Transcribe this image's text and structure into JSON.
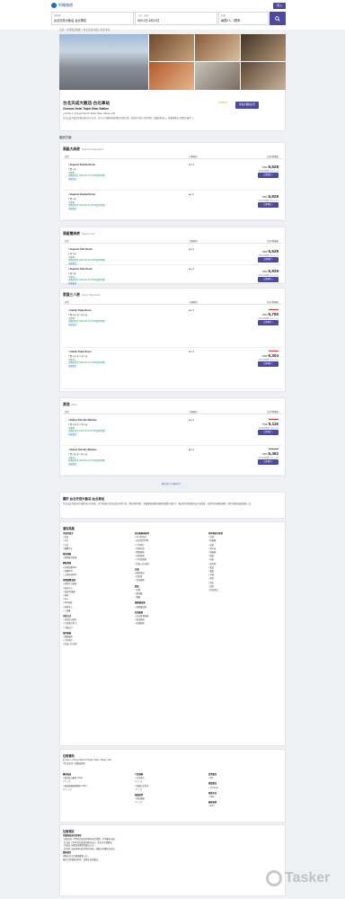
{
  "header": {
    "logo_text": "阿頓旅遊",
    "login_label": "登入",
    "search": {
      "dest_label": "目的地",
      "dest_value": "台北天成大飯店-台北車站",
      "date_label": "入住 - 退房",
      "date_value": "8月12日-8月13日",
      "guest_label": "房客",
      "guest_value": "每間2人, 1間房"
    }
  },
  "breadcrumb": "首頁 > 台灣飯店推薦 > 台北天成大飯店-台北車站",
  "hotel": {
    "name": "台北天成大飯店-台北車站",
    "name_en": "Cosmos Hotel Taipei Main Station",
    "address": "43 Sec 1, Chung Hsiao W. Road, Taipei, Taiwan, 100",
    "desc": "台北天成大飯店坐落於臺北市中正區，位於公共運輸站點與觀光商場之間，從此地可前往台北地標，周邊景點多元，距離捷運站只需數分鐘步行。",
    "stars": "★★★★",
    "reserve_label": "查看房價與房型"
  },
  "rooms_section_label": "客房方案",
  "room_groups": [
    {
      "title": "高級大床房",
      "title_en": "Superior Double Room",
      "col_type": "房型",
      "col_occ": "人數限制",
      "col_price": "每房/晚價格",
      "rooms": [
        {
          "name": "Superior Double Room",
          "l1": "1 雙人床",
          "l2": "早餐費",
          "l3": "免費取消至 2024-08-10 23:59(當地時間)",
          "l4": "詳細資訊",
          "occ": "x 4",
          "was": "",
          "price": "5,528",
          "tax": "含稅及服務費 TWD 5,528",
          "book": "立即預訂"
        },
        {
          "name": "Superior Double Room",
          "l1": "1 雙人床",
          "l2": "早餐費",
          "l3": "免費取消至 2024-08-10 23:59(當地時間)",
          "l4": "詳細資訊",
          "occ": "x 2",
          "was": "",
          "price": "5,929",
          "tax": "含稅及服務費 TWD 5,929",
          "book": "立即預訂"
        }
      ]
    },
    {
      "title": "高級雙床房",
      "title_en": "Superior Twin",
      "col_type": "房型",
      "col_occ": "人數限制",
      "col_price": "每房/晚價格",
      "rooms": [
        {
          "name": "Superior Twin Room",
          "l1": "2 單人床",
          "l2": "早餐費",
          "l3": "免費取消至 2024-08-10 23:59(當地時間)",
          "l4": "詳細資訊",
          "occ": "x 2",
          "was": "",
          "price": "5,528",
          "tax": "含稅及服務費 TWD 5,528",
          "book": "立即預訂"
        },
        {
          "name": "Superior Twin Room",
          "l1": "2 單人床",
          "l2": "早餐加入",
          "l3": "免費取消至 2024-08-10 23:59(當地時間)",
          "l4": "詳細資訊",
          "occ": "x 2",
          "was": "",
          "price": "5,929",
          "tax": "含稅及服務費 TWD 5,929",
          "book": "立即預訂"
        }
      ]
    },
    {
      "title": "家庭三人房",
      "title_en": "Family Triple Room",
      "col_type": "房型",
      "col_occ": "人數限制",
      "col_price": "每房/晚價格",
      "rooms": [
        {
          "name": "Family Triple Room",
          "l1": "1 雙人床 和 1 單人床",
          "l2": "早餐費",
          "l3": "免費取消至 2024-08-10 23:59(當地時間)",
          "l4": "詳細資訊",
          "occ": "x 3",
          "was": "TWD 6,395",
          "price": "5,755",
          "tax": "含稅及服務費 TWD 5,755",
          "book": "立即預訂"
        },
        {
          "name": "Family Triple Room",
          "l1": "1 雙人床 和 1 單人床",
          "l2": "早餐加入",
          "l3": "免費取消至 2024-08-10 23:59(當地時間)",
          "l4": "詳細資訊",
          "occ": "x 3",
          "was": "TWD 7,004",
          "price": "6,304",
          "tax": "含稅及服務費 TWD 6,304",
          "book": "立即預訂"
        }
      ]
    },
    {
      "title": "其他",
      "title_en": "Other",
      "col_type": "房型",
      "col_occ": "人數限制",
      "col_price": "每房/晚價格",
      "rooms": [
        {
          "name": "Deluxe Twin No Window",
          "l1": "1 雙人床 和 1 單人床",
          "l2": "早餐費",
          "l3": "免費取消至 2024-08-10 23:59(當地時間)",
          "l4": "詳細資訊",
          "occ": "x 2",
          "was": "TWD 5,684",
          "price": "5,116",
          "tax": "含稅及服務費 TWD 5,116",
          "book": "立即預訂"
        },
        {
          "name": "Deluxe Twin No Window",
          "l1": "1 雙人床 和 1 單人床",
          "l2": "早餐加入",
          "l3": "免費取消至 2024-08-10 23:59(當地時間)",
          "l4": "詳細資訊",
          "occ": "x 2",
          "was": "TWD 6,091",
          "price": "5,482",
          "tax": "含稅及服務費 TWD 5,482",
          "book": "立即預訂"
        }
      ]
    }
  ],
  "more_rooms_label": "顯示其它 5 間房型 ▾",
  "about": {
    "title": "關於 台北天成大飯店-台北車站",
    "text": "台北天成大飯店位於臺北車站正對面，步行即達台北車站及台北地下街，鄰近博愛特區，距離捷運及機場捷運皆僅數分鐘步行。飯店提供舒適客房及完善設施，並提供多項餐飲選擇，適合商務及旅遊旅客入住。"
  },
  "facilities": {
    "title": "酒店設施",
    "col1": [
      {
        "h": "可使用語言",
        "items": [
          "英語",
          "中文",
          "日語",
          "繁體中文"
        ]
      },
      {
        "h": "客房服務",
        "items": [
          "限時客房服務"
        ]
      },
      {
        "h": "網路連線",
        "items": [
          "室內免費WiFi",
          "免費WiFi",
          "公用區域WiFi"
        ]
      },
      {
        "h": "休閒娛樂設施",
        "items": [
          "商務中心服務",
          "健身中心",
          "會議/宴會廳",
          "酒吧",
          "Spa",
          "SPA按摩",
          "商務中心",
          "三溫暖"
        ]
      },
      {
        "h": "付款方式",
        "items": [
          "有效身分證件",
          "可使用信用卡",
          "行動支付"
        ]
      },
      {
        "h": "接待服務",
        "items": [
          "禮賓服務",
          "行李寄存",
          "快速入住/退房"
        ]
      }
    ],
    "col2": [
      {
        "h": "前台服務與接待",
        "items": [
          "24小時前台",
          "前台提供門票",
          "行李寄存",
          "外幣兌換",
          "禮賓服務",
          "叫車服務",
          "行李員服務",
          "快速入住/退房"
        ]
      },
      {
        "h": "交通",
        "items": [
          "機場接送",
          "停車場",
          "洗衣服務"
        ]
      },
      {
        "h": "餐飲",
        "items": [
          "早餐",
          "咖啡廳",
          "餐廳"
        ]
      },
      {
        "h": "無障礙設施",
        "items": [
          "無障礙設施"
        ]
      },
      {
        "h": "清潔服務",
        "items": [
          "每日清潔服務",
          "乾洗服務",
          "熨燙服務"
        ]
      }
    ],
    "col3": [
      {
        "h": "所有客房內提供",
        "items": [
          "空調",
          "吹風機",
          "衣架",
          "熱水壺",
          "保險箱",
          "拖鞋",
          "浴袍",
          "迷你吧",
          "電話",
          "電視",
          "冰箱",
          "書桌",
          "浴缸",
          "淋浴",
          "盥洗用品"
        ]
      }
    ]
  },
  "info": {
    "title": "住宿資訊",
    "address": "43 Sec 1, Chung Hsiao W. Road, Taipei, Taiwan, 100",
    "nearby": "中正紀念堂 / 國家圖書館",
    "airport_h": "機場接送",
    "airport_1": "臺北松山機場 (TSA)",
    "airport_1d": "4.8 公里",
    "airport_2": "臺灣桃園國際機場 (TPE)",
    "airport_2d": "39.0 公里",
    "transit_h": "大眾運輸",
    "transit_1": "台北車站",
    "transit_1d": "0.2 公里",
    "transit_2": "捷運台北車站",
    "transit_2d": "0.3 公里",
    "food_h": "周邊美食",
    "food_1": "附近餐廳",
    "food_1d": "0.1 公里",
    "rooms_h": "房間數目",
    "rooms_v": "224",
    "floors_h": "樓層數目",
    "floors_v": "17 Floors",
    "year_h": "開業年份",
    "year_v": "1991",
    "year_v2": "2017",
    "renov_h": "最後裝修",
    "renov_v": "2017"
  },
  "policy": {
    "title": "住宿規定",
    "h1": "兒童與加床住房規定",
    "p1": "【嬰幼兒】0至6歲兒童使用現有床位免費，不需額外加床。",
    "p2": "【兒童】7至12歲兒童使用現有床位，需支付早餐費用。",
    "p3": "【加床】每晚加床費用依飯店公告。",
    "p4": "【其他】加床與嬰兒床需事先申請，視飯店供應狀況而定。",
    "h2": "寵物規定",
    "p5": "本飯店不允許攜帶寵物入住。",
    "p6": "導盲犬等服務犬除外，請事先告知飯店。"
  },
  "watermark": "Tasker"
}
